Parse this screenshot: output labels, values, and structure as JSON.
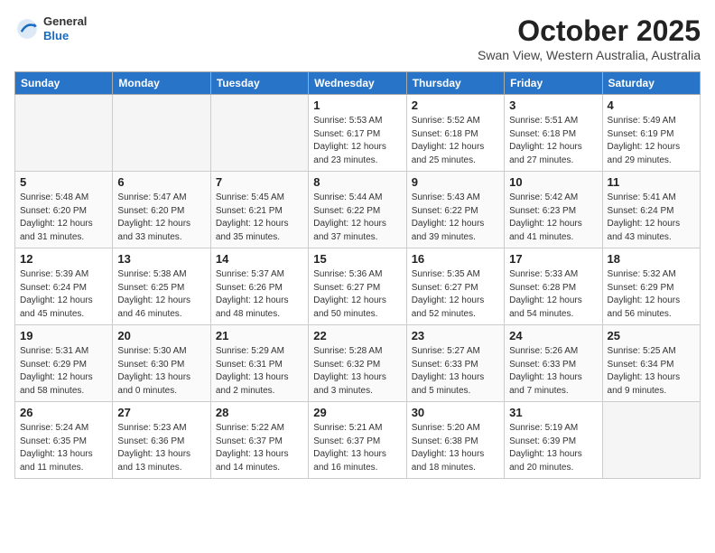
{
  "header": {
    "logo_general": "General",
    "logo_blue": "Blue",
    "month_title": "October 2025",
    "location": "Swan View, Western Australia, Australia"
  },
  "days_of_week": [
    "Sunday",
    "Monday",
    "Tuesday",
    "Wednesday",
    "Thursday",
    "Friday",
    "Saturday"
  ],
  "weeks": [
    [
      {
        "day": "",
        "info": ""
      },
      {
        "day": "",
        "info": ""
      },
      {
        "day": "",
        "info": ""
      },
      {
        "day": "1",
        "info": "Sunrise: 5:53 AM\nSunset: 6:17 PM\nDaylight: 12 hours\nand 23 minutes."
      },
      {
        "day": "2",
        "info": "Sunrise: 5:52 AM\nSunset: 6:18 PM\nDaylight: 12 hours\nand 25 minutes."
      },
      {
        "day": "3",
        "info": "Sunrise: 5:51 AM\nSunset: 6:18 PM\nDaylight: 12 hours\nand 27 minutes."
      },
      {
        "day": "4",
        "info": "Sunrise: 5:49 AM\nSunset: 6:19 PM\nDaylight: 12 hours\nand 29 minutes."
      }
    ],
    [
      {
        "day": "5",
        "info": "Sunrise: 5:48 AM\nSunset: 6:20 PM\nDaylight: 12 hours\nand 31 minutes."
      },
      {
        "day": "6",
        "info": "Sunrise: 5:47 AM\nSunset: 6:20 PM\nDaylight: 12 hours\nand 33 minutes."
      },
      {
        "day": "7",
        "info": "Sunrise: 5:45 AM\nSunset: 6:21 PM\nDaylight: 12 hours\nand 35 minutes."
      },
      {
        "day": "8",
        "info": "Sunrise: 5:44 AM\nSunset: 6:22 PM\nDaylight: 12 hours\nand 37 minutes."
      },
      {
        "day": "9",
        "info": "Sunrise: 5:43 AM\nSunset: 6:22 PM\nDaylight: 12 hours\nand 39 minutes."
      },
      {
        "day": "10",
        "info": "Sunrise: 5:42 AM\nSunset: 6:23 PM\nDaylight: 12 hours\nand 41 minutes."
      },
      {
        "day": "11",
        "info": "Sunrise: 5:41 AM\nSunset: 6:24 PM\nDaylight: 12 hours\nand 43 minutes."
      }
    ],
    [
      {
        "day": "12",
        "info": "Sunrise: 5:39 AM\nSunset: 6:24 PM\nDaylight: 12 hours\nand 45 minutes."
      },
      {
        "day": "13",
        "info": "Sunrise: 5:38 AM\nSunset: 6:25 PM\nDaylight: 12 hours\nand 46 minutes."
      },
      {
        "day": "14",
        "info": "Sunrise: 5:37 AM\nSunset: 6:26 PM\nDaylight: 12 hours\nand 48 minutes."
      },
      {
        "day": "15",
        "info": "Sunrise: 5:36 AM\nSunset: 6:27 PM\nDaylight: 12 hours\nand 50 minutes."
      },
      {
        "day": "16",
        "info": "Sunrise: 5:35 AM\nSunset: 6:27 PM\nDaylight: 12 hours\nand 52 minutes."
      },
      {
        "day": "17",
        "info": "Sunrise: 5:33 AM\nSunset: 6:28 PM\nDaylight: 12 hours\nand 54 minutes."
      },
      {
        "day": "18",
        "info": "Sunrise: 5:32 AM\nSunset: 6:29 PM\nDaylight: 12 hours\nand 56 minutes."
      }
    ],
    [
      {
        "day": "19",
        "info": "Sunrise: 5:31 AM\nSunset: 6:29 PM\nDaylight: 12 hours\nand 58 minutes."
      },
      {
        "day": "20",
        "info": "Sunrise: 5:30 AM\nSunset: 6:30 PM\nDaylight: 13 hours\nand 0 minutes."
      },
      {
        "day": "21",
        "info": "Sunrise: 5:29 AM\nSunset: 6:31 PM\nDaylight: 13 hours\nand 2 minutes."
      },
      {
        "day": "22",
        "info": "Sunrise: 5:28 AM\nSunset: 6:32 PM\nDaylight: 13 hours\nand 3 minutes."
      },
      {
        "day": "23",
        "info": "Sunrise: 5:27 AM\nSunset: 6:33 PM\nDaylight: 13 hours\nand 5 minutes."
      },
      {
        "day": "24",
        "info": "Sunrise: 5:26 AM\nSunset: 6:33 PM\nDaylight: 13 hours\nand 7 minutes."
      },
      {
        "day": "25",
        "info": "Sunrise: 5:25 AM\nSunset: 6:34 PM\nDaylight: 13 hours\nand 9 minutes."
      }
    ],
    [
      {
        "day": "26",
        "info": "Sunrise: 5:24 AM\nSunset: 6:35 PM\nDaylight: 13 hours\nand 11 minutes."
      },
      {
        "day": "27",
        "info": "Sunrise: 5:23 AM\nSunset: 6:36 PM\nDaylight: 13 hours\nand 13 minutes."
      },
      {
        "day": "28",
        "info": "Sunrise: 5:22 AM\nSunset: 6:37 PM\nDaylight: 13 hours\nand 14 minutes."
      },
      {
        "day": "29",
        "info": "Sunrise: 5:21 AM\nSunset: 6:37 PM\nDaylight: 13 hours\nand 16 minutes."
      },
      {
        "day": "30",
        "info": "Sunrise: 5:20 AM\nSunset: 6:38 PM\nDaylight: 13 hours\nand 18 minutes."
      },
      {
        "day": "31",
        "info": "Sunrise: 5:19 AM\nSunset: 6:39 PM\nDaylight: 13 hours\nand 20 minutes."
      },
      {
        "day": "",
        "info": ""
      }
    ]
  ]
}
